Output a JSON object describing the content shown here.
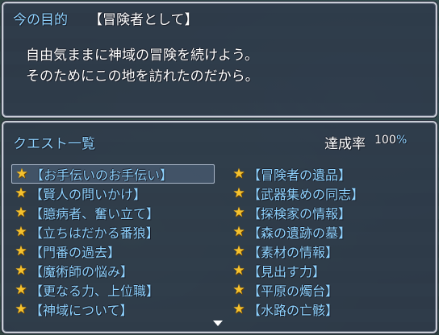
{
  "goal": {
    "label": "今の目的",
    "title": "【冒険者として】",
    "line1": "自由気ままに神域の冒険を続けよう。",
    "line2": "そのためにこの地を訪れたのだから。"
  },
  "quests": {
    "header": "クエスト一覧",
    "rate_label": "達成率",
    "rate_value": "100",
    "rate_unit": "%",
    "star_icon": "star-icon",
    "star_color": "#f5c22e",
    "left": [
      {
        "label": "【お手伝いのお手伝い】",
        "selected": true
      },
      {
        "label": "【賢人の問いかけ】"
      },
      {
        "label": "【臆病者、奮い立て】"
      },
      {
        "label": "【立ちはだかる番狼】"
      },
      {
        "label": "【門番の過去】"
      },
      {
        "label": "【魔術師の悩み】"
      },
      {
        "label": "【更なる力、上位職】"
      },
      {
        "label": "【神域について】"
      }
    ],
    "right": [
      {
        "label": "【冒険者の遺品】"
      },
      {
        "label": "【武器集めの同志】"
      },
      {
        "label": "【探検家の情報】"
      },
      {
        "label": "【森の遺跡の墓】"
      },
      {
        "label": "【素材の情報】"
      },
      {
        "label": "【見出す力】"
      },
      {
        "label": "【平原の燭台】"
      },
      {
        "label": "【水路の亡骸】"
      }
    ]
  },
  "colors": {
    "system_text": "#8fd3ff",
    "normal_text": "#ffffff",
    "window_bg": "#2e3a4a"
  }
}
